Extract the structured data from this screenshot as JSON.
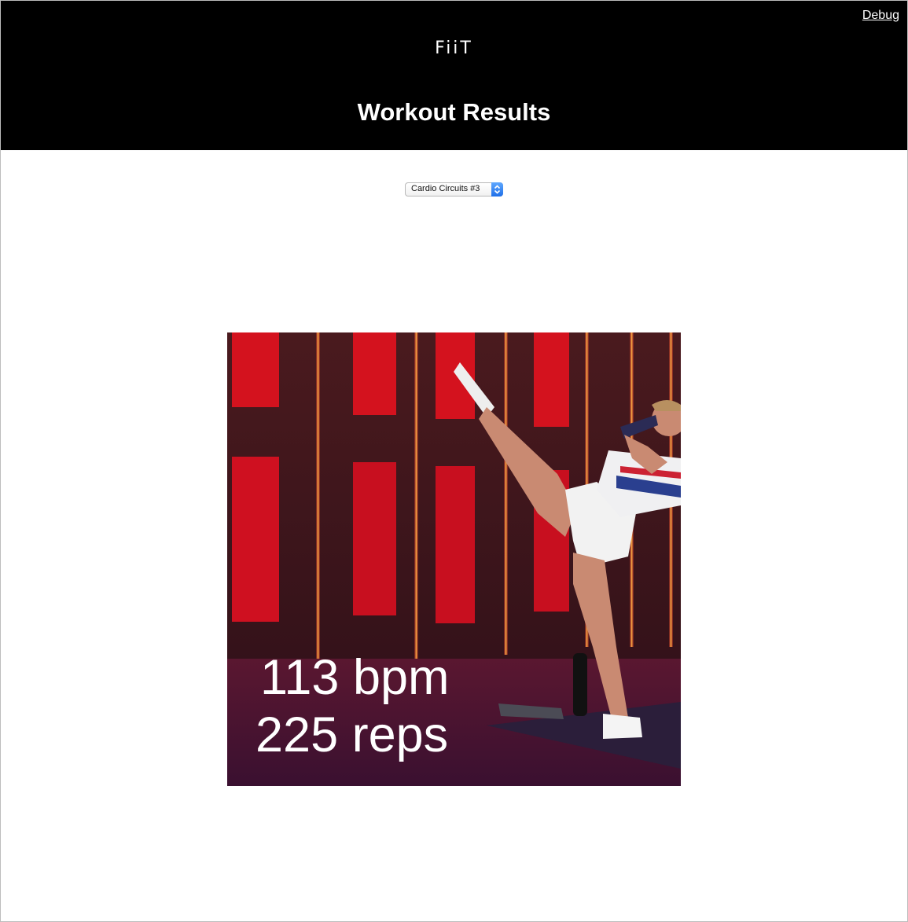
{
  "header": {
    "debug_link": "Debug",
    "logo": "FiiT",
    "title": "Workout Results",
    "background": "#000000"
  },
  "workout_select": {
    "selected": "Cardio Circuits #3",
    "accent": "#1f6fe8"
  },
  "hero": {
    "heart_rate": "113 bpm",
    "reps": "225 reps",
    "accent": "#e3122a"
  }
}
